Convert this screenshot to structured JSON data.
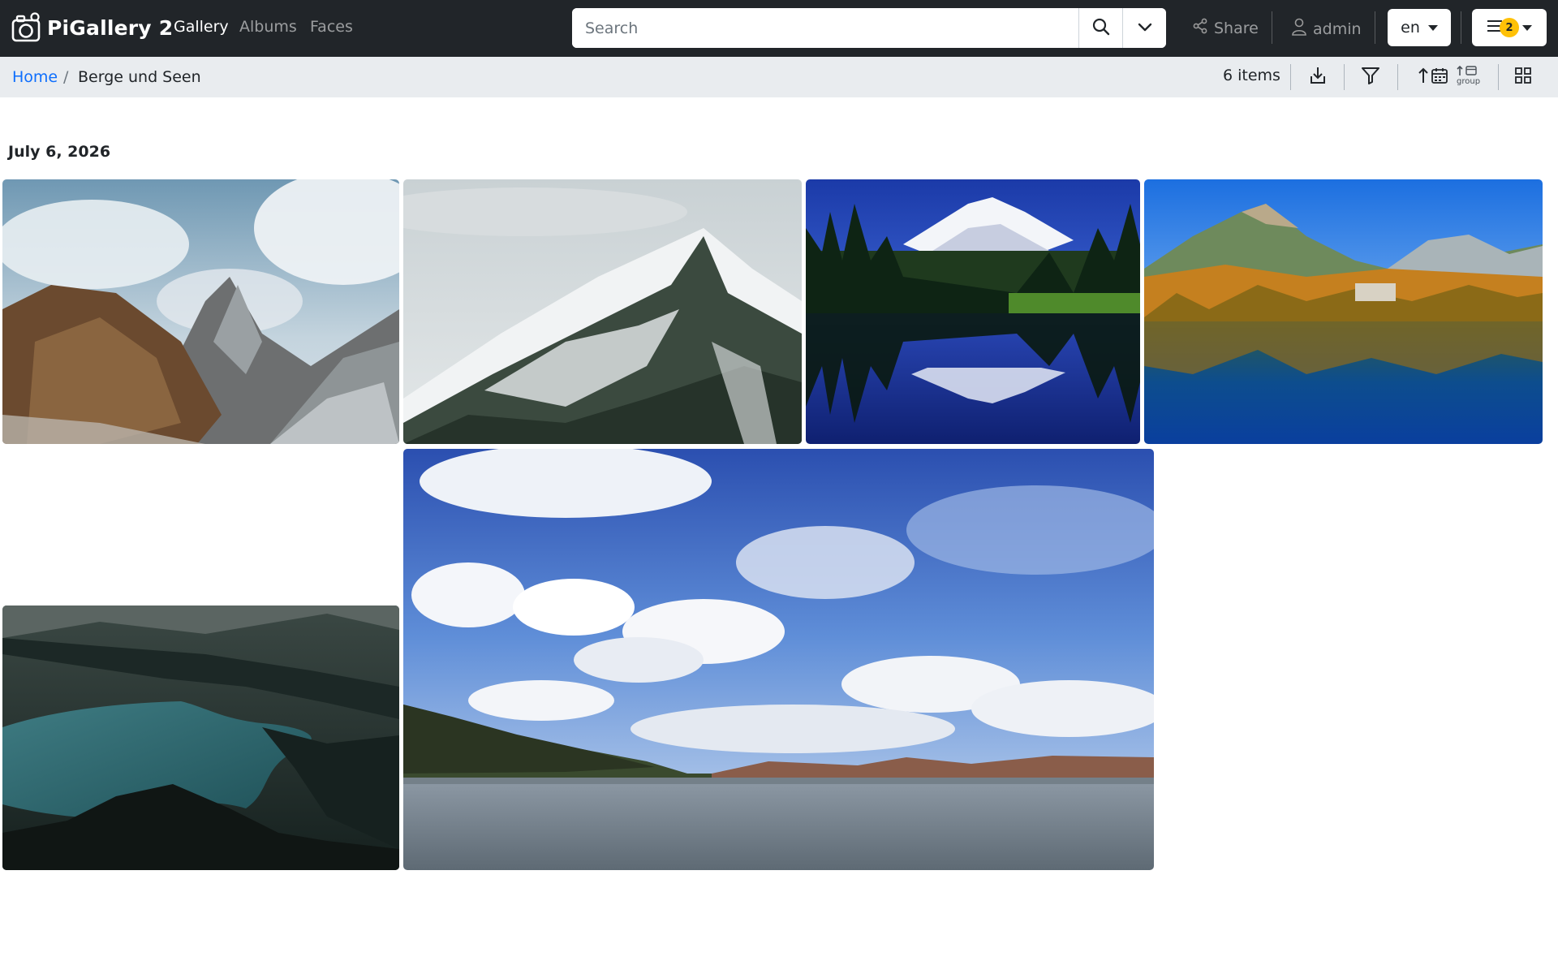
{
  "app": {
    "title": "PiGallery 2"
  },
  "nav": {
    "links": [
      {
        "label": "Gallery",
        "active": true
      },
      {
        "label": "Albums",
        "active": false
      },
      {
        "label": "Faces",
        "active": false
      }
    ],
    "search": {
      "placeholder": "Search"
    },
    "share_label": "Share",
    "user_label": "admin",
    "language": "en",
    "menu_badge": "2",
    "badge_color": "#ffc107"
  },
  "breadcrumb": {
    "home": "Home",
    "separator": "/",
    "current": "Berge und Seen"
  },
  "toolbar": {
    "item_count": "6 items",
    "group_label": "group"
  },
  "gallery": {
    "date": "July 6, 2026",
    "photos": [
      {
        "subject": "rocky mountain peak with clouds"
      },
      {
        "subject": "snowy forested mountain ridge"
      },
      {
        "subject": "snow volcano reflected in lake"
      },
      {
        "subject": "alpine lake with autumn forest"
      },
      {
        "subject": "dark turquoise mountain lake"
      },
      {
        "subject": "lake under cloudy blue sky"
      }
    ]
  },
  "colors": {
    "navbar": "#212529",
    "subbar": "#e9ecef",
    "link": "#0d6efd"
  }
}
